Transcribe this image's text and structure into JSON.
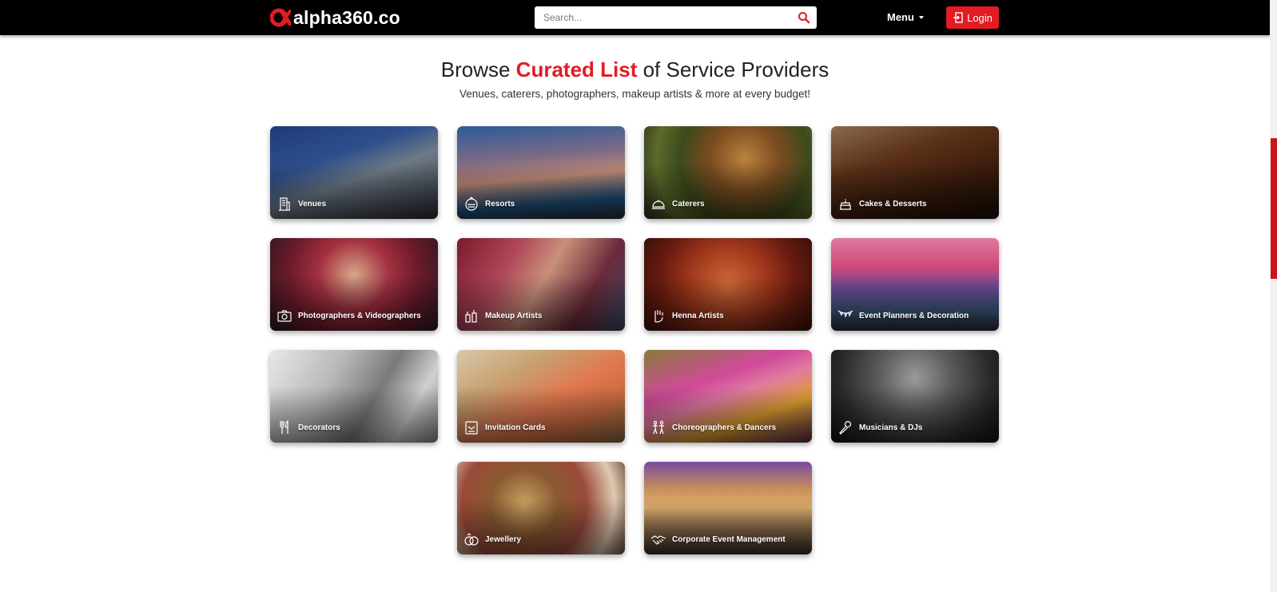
{
  "header": {
    "logo_text": "alpha360.co",
    "search_placeholder": "Search...",
    "menu_label": "Menu",
    "login_label": "Login"
  },
  "hero": {
    "title_before": "Browse ",
    "title_accent": "Curated List",
    "title_after": " of Service Providers",
    "subtitle": "Venues, caterers, photographers, makeup artists & more at every budget!"
  },
  "categories": [
    {
      "label": "Venues",
      "icon": "building-icon"
    },
    {
      "label": "Resorts",
      "icon": "resort-icon"
    },
    {
      "label": "Caterers",
      "icon": "cloche-icon"
    },
    {
      "label": "Cakes & Desserts",
      "icon": "cake-icon"
    },
    {
      "label": "Photographers & Videographers",
      "icon": "camera-icon"
    },
    {
      "label": "Makeup Artists",
      "icon": "makeup-icon"
    },
    {
      "label": "Henna Artists",
      "icon": "henna-hand-icon"
    },
    {
      "label": "Event Planners & Decoration",
      "icon": "bunting-icon"
    },
    {
      "label": "Decorators",
      "icon": "cutlery-icon"
    },
    {
      "label": "Invitation Cards",
      "icon": "invitation-icon"
    },
    {
      "label": "Choreographers & Dancers",
      "icon": "dancers-icon"
    },
    {
      "label": "Musicians & DJs",
      "icon": "microphone-icon"
    },
    {
      "label": "Jewellery",
      "icon": "rings-icon"
    },
    {
      "label": "Corporate Event Management",
      "icon": "handshake-icon"
    }
  ],
  "colors": {
    "brand": "#e31b23",
    "header_bg": "#000000"
  }
}
